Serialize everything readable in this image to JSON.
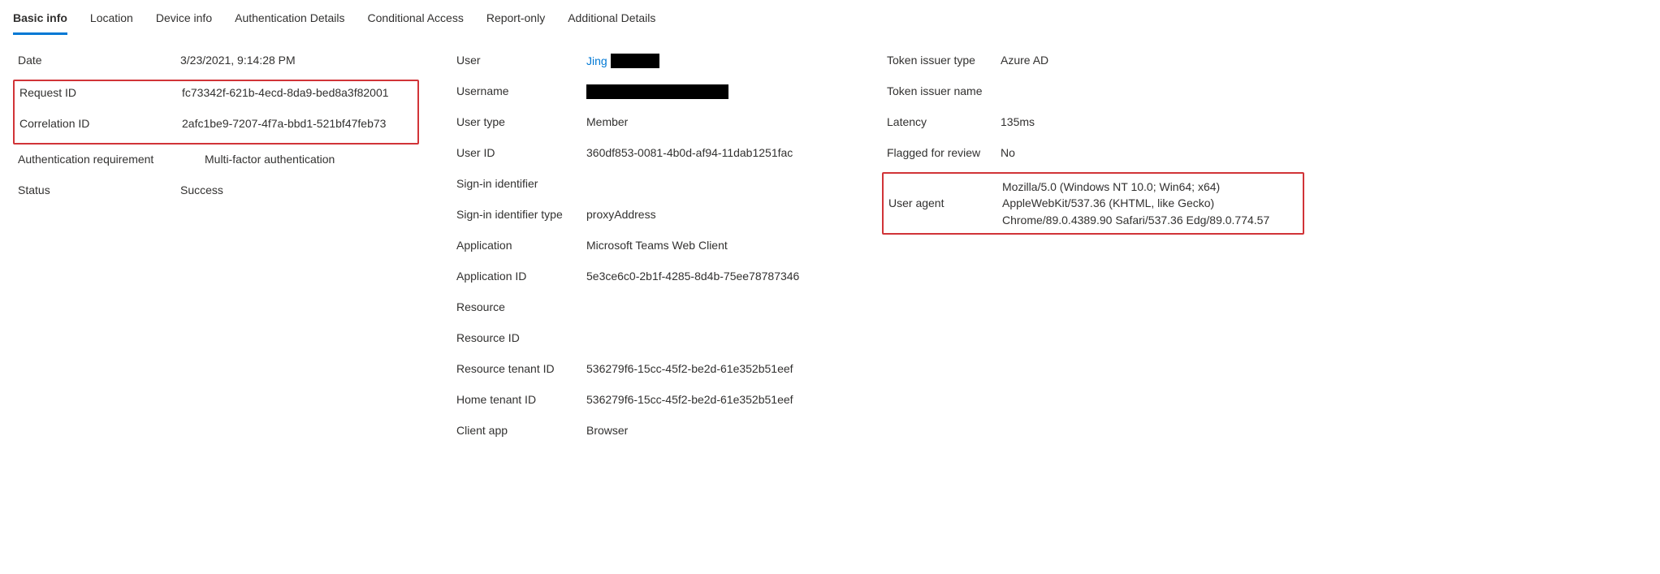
{
  "tabs": [
    {
      "label": "Basic info",
      "active": true
    },
    {
      "label": "Location",
      "active": false
    },
    {
      "label": "Device info",
      "active": false
    },
    {
      "label": "Authentication Details",
      "active": false
    },
    {
      "label": "Conditional Access",
      "active": false
    },
    {
      "label": "Report-only",
      "active": false
    },
    {
      "label": "Additional Details",
      "active": false
    }
  ],
  "col1": {
    "date_label": "Date",
    "date_value": "3/23/2021, 9:14:28 PM",
    "request_id_label": "Request ID",
    "request_id_value": "fc73342f-621b-4ecd-8da9-bed8a3f82001",
    "correlation_id_label": "Correlation ID",
    "correlation_id_value": "2afc1be9-7207-4f7a-bbd1-521bf47feb73",
    "auth_req_label": "Authentication requirement",
    "auth_req_value": "Multi-factor authentication",
    "status_label": "Status",
    "status_value": "Success"
  },
  "col2": {
    "user_label": "User",
    "user_value_visible": "Jing",
    "username_label": "Username",
    "user_type_label": "User type",
    "user_type_value": "Member",
    "user_id_label": "User ID",
    "user_id_value": "360df853-0081-4b0d-af94-11dab1251fac",
    "signin_id_label": "Sign-in identifier",
    "signin_id_value": "",
    "signin_id_type_label": "Sign-in identifier type",
    "signin_id_type_value": "proxyAddress",
    "application_label": "Application",
    "application_value": "Microsoft Teams Web Client",
    "application_id_label": "Application ID",
    "application_id_value": "5e3ce6c0-2b1f-4285-8d4b-75ee78787346",
    "resource_label": "Resource",
    "resource_value": "",
    "resource_id_label": "Resource ID",
    "resource_id_value": "",
    "resource_tenant_label": "Resource tenant ID",
    "resource_tenant_value": "536279f6-15cc-45f2-be2d-61e352b51eef",
    "home_tenant_label": "Home tenant ID",
    "home_tenant_value": "536279f6-15cc-45f2-be2d-61e352b51eef",
    "client_app_label": "Client app",
    "client_app_value": "Browser"
  },
  "col3": {
    "token_issuer_type_label": "Token issuer type",
    "token_issuer_type_value": "Azure AD",
    "token_issuer_name_label": "Token issuer name",
    "token_issuer_name_value": "",
    "latency_label": "Latency",
    "latency_value": "135ms",
    "flagged_label": "Flagged for review",
    "flagged_value": "No",
    "user_agent_label": "User agent",
    "user_agent_value": "Mozilla/5.0 (Windows NT 10.0; Win64; x64) AppleWebKit/537.36 (KHTML, like Gecko) Chrome/89.0.4389.90 Safari/537.36 Edg/89.0.774.57"
  }
}
